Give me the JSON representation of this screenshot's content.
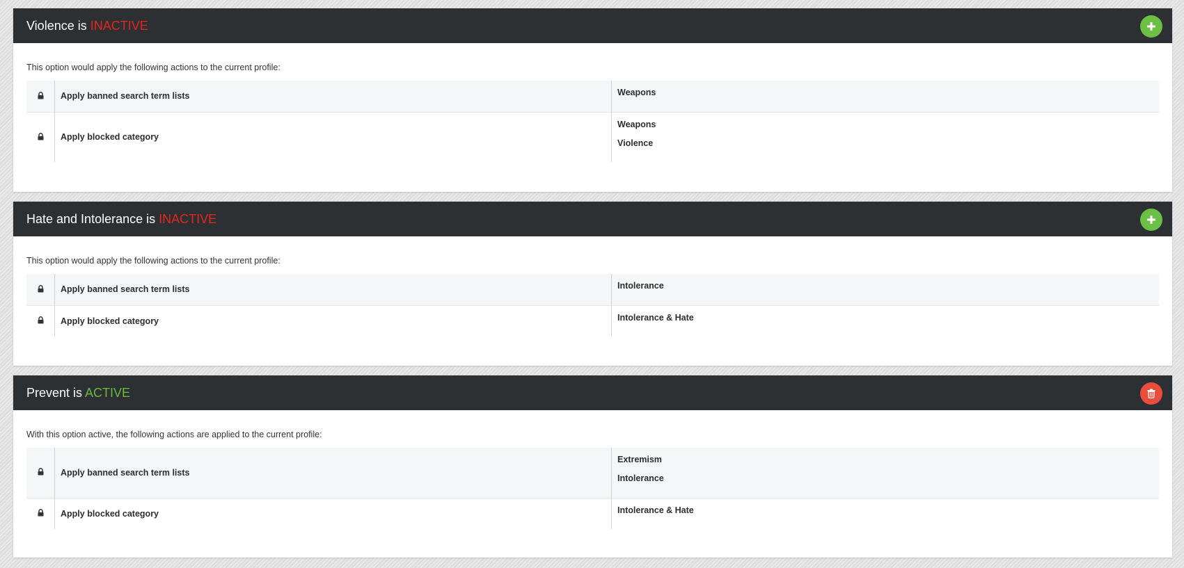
{
  "panels": [
    {
      "title_prefix": "Violence is ",
      "status": "INACTIVE",
      "status_color": "#e3261f",
      "action": "add",
      "action_icon": "plus-icon",
      "intro": "This option would apply the following actions to the current profile:",
      "rows": [
        {
          "label": "Apply banned search term lists",
          "values": [
            "Weapons"
          ]
        },
        {
          "label": "Apply blocked category",
          "values": [
            "Weapons",
            "Violence"
          ]
        }
      ]
    },
    {
      "title_prefix": "Hate and Intolerance is ",
      "status": "INACTIVE",
      "status_color": "#e3261f",
      "action": "add",
      "action_icon": "plus-icon",
      "intro": "This option would apply the following actions to the current profile:",
      "rows": [
        {
          "label": "Apply banned search term lists",
          "values": [
            "Intolerance"
          ]
        },
        {
          "label": "Apply blocked category",
          "values": [
            "Intolerance & Hate"
          ]
        }
      ]
    },
    {
      "title_prefix": "Prevent is ",
      "status": "ACTIVE",
      "status_color": "#6bb83d",
      "action": "remove",
      "action_icon": "trash-icon",
      "intro": "With this option active, the following actions are applied to the current profile:",
      "rows": [
        {
          "label": "Apply banned search term lists",
          "values": [
            "Extremism",
            "Intolerance"
          ]
        },
        {
          "label": "Apply blocked category",
          "values": [
            "Intolerance & Hate"
          ]
        }
      ]
    }
  ],
  "icons": {
    "row": "lock-icon"
  },
  "colors": {
    "header_bg": "#2d3033",
    "add_button": "#6cbf45",
    "remove_button": "#ea4d3d"
  }
}
